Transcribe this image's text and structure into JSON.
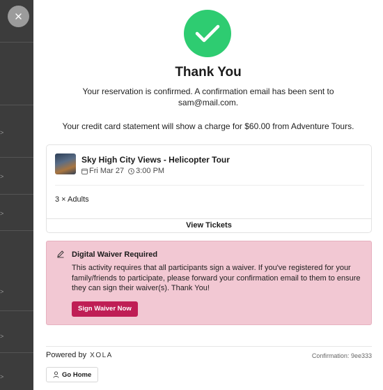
{
  "modal": {
    "title": "Thank You",
    "confirmation_message": "Your reservation is confirmed. A confirmation email has been sent to sam@mail.com.",
    "charge_message": "Your credit card statement will show a charge for $60.00 from Adventure Tours."
  },
  "booking": {
    "tour_name": "Sky High City Views - Helicopter Tour",
    "date": "Fri Mar 27",
    "time": "3:00 PM",
    "quantity": "3 × Adults",
    "view_tickets_label": "View Tickets"
  },
  "waiver": {
    "title": "Digital Waiver Required",
    "body": "This activity requires that all participants sign a waiver. If you've registered for your family/friends to participate, please forward your confirmation email to them to ensure they can sign their waiver(s). Thank You!",
    "button_label": "Sign Waiver Now"
  },
  "footer": {
    "powered_by": "Powered by",
    "brand": "XOLA",
    "confirmation_label": "Confirmation:",
    "confirmation_code": "9ee333",
    "go_home_label": "Go Home"
  },
  "colors": {
    "success": "#2ecc71",
    "waiver_bg": "#f2c8d3",
    "waiver_button": "#bf1e55"
  },
  "icons": [
    "close-icon",
    "checkmark-icon",
    "calendar-icon",
    "clock-icon",
    "pencil-icon",
    "user-icon"
  ]
}
